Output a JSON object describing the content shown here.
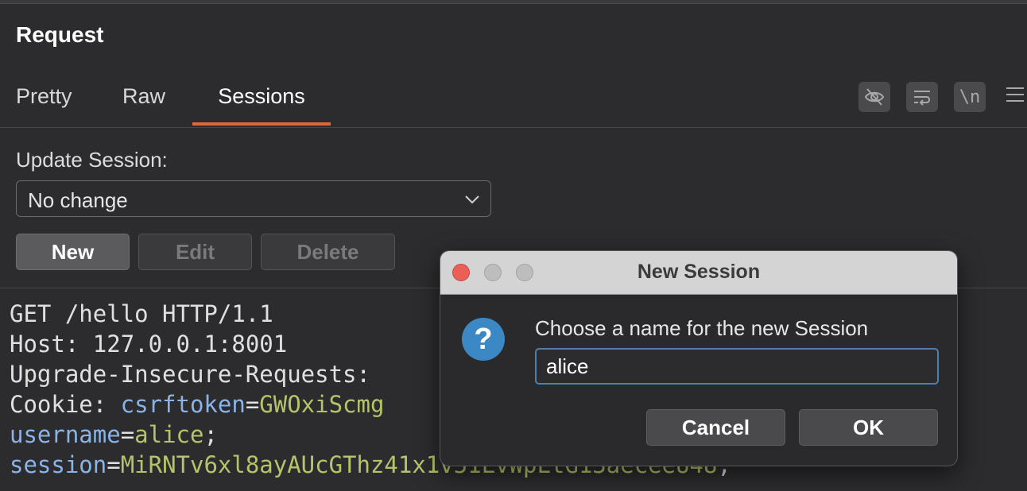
{
  "panel": {
    "title": "Request"
  },
  "tabs": [
    {
      "label": "Pretty",
      "active": false
    },
    {
      "label": "Raw",
      "active": false
    },
    {
      "label": "Sessions",
      "active": true
    }
  ],
  "toolbar": {
    "hide_icon": "eye-slash-icon",
    "wrap_icon": "word-wrap-icon",
    "newline_label": "\\n",
    "menu_icon": "hamburger-menu-icon"
  },
  "session": {
    "update_label": "Update Session:",
    "select_value": "No change",
    "buttons": {
      "new": "New",
      "edit": "Edit",
      "delete": "Delete"
    }
  },
  "request": {
    "line1": "GET /hello HTTP/1.1",
    "host_key": "Host:",
    "host_value": " 127.0.0.1:8001",
    "upgrade_key": "Upgrade-Insecure-Requests:",
    "cookie_key": "Cookie:",
    "csrf_name": " csrftoken",
    "eq1": "=",
    "csrf_value": "GWOxiScmg",
    "username_name": "username",
    "eq2": "=",
    "username_value": "alice",
    "semicolon1": ";",
    "session_name": "session",
    "eq3": "=",
    "session_value": "MiRNTv6xl8ayAUcGThz41x1v51LvWpLtG13aeceeU48",
    "semicolon2": ";"
  },
  "dialog": {
    "title": "New Session",
    "prompt": "Choose a name for the new Session",
    "input_value": "alice",
    "cancel_label": "Cancel",
    "ok_label": "OK",
    "icon": "question-icon",
    "icon_glyph": "?"
  },
  "colors": {
    "accent": "#e0693b",
    "header_name": "#8ab4e8",
    "cookie_value": "#b5c46a",
    "help_icon": "#3b88c4"
  }
}
